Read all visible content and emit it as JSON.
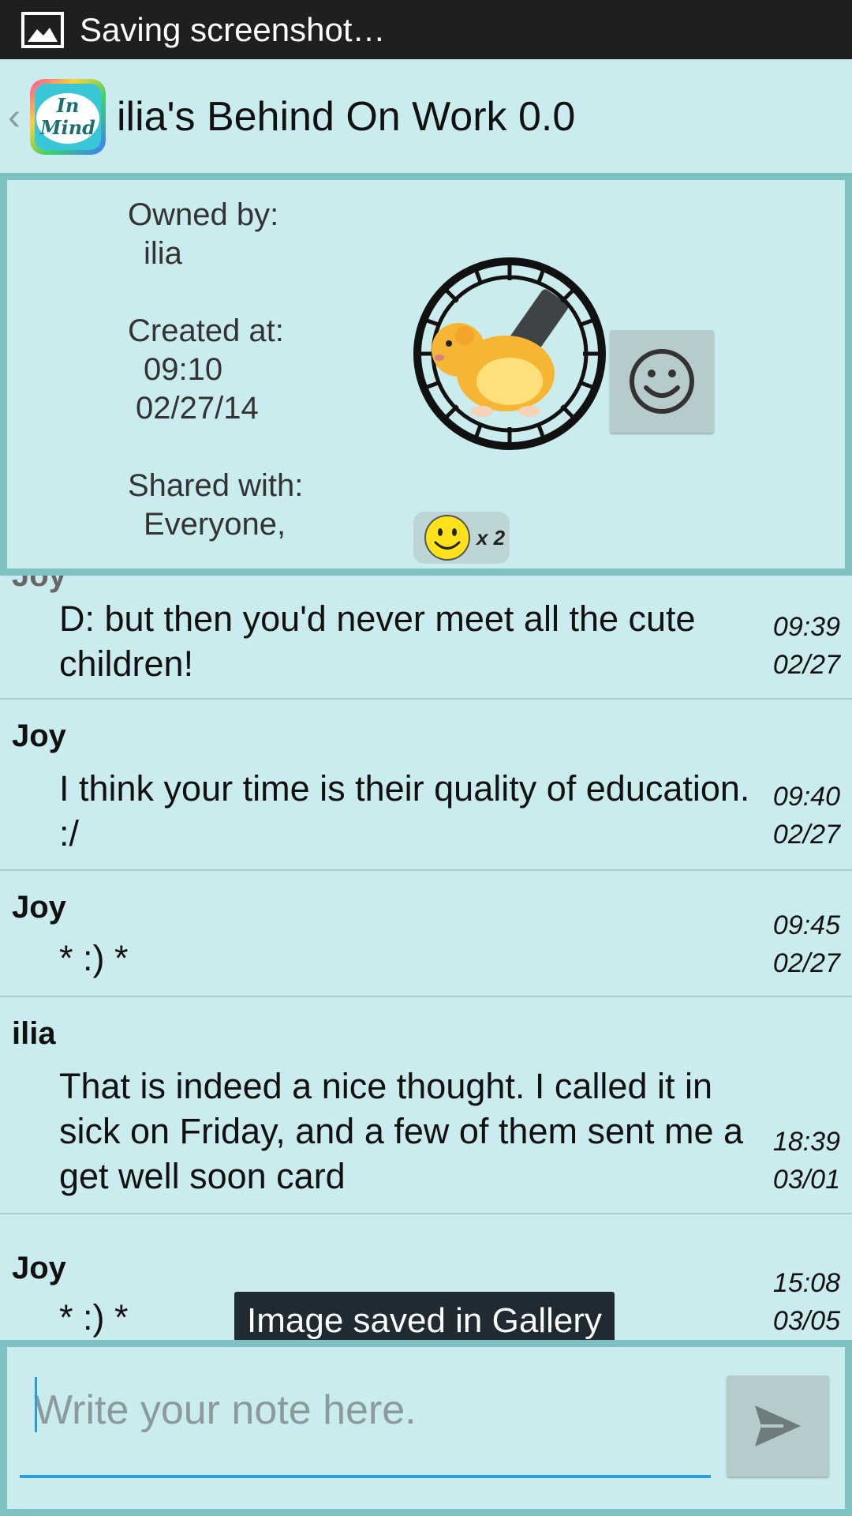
{
  "status_bar": {
    "text": "Saving screenshot…",
    "icon": "gallery-icon"
  },
  "action_bar": {
    "title": "ilia's Behind On Work 0.0",
    "app_icon_text": [
      "In",
      "Mind"
    ]
  },
  "info": {
    "owned_label": "Owned by:",
    "owner": "ilia",
    "created_label": "Created at:",
    "created_time": "09:10",
    "created_date": "02/27/14",
    "shared_label": "Shared with:",
    "shared_with": "Everyone,",
    "reaction_count": "x 2"
  },
  "messages": [
    {
      "author": "Joy",
      "text": "D: but then you'd never meet all the cute children!",
      "time": "09:39",
      "date": "02/27"
    },
    {
      "author": "Joy",
      "text": "I think your time is their quality of education. :/",
      "time": "09:40",
      "date": "02/27"
    },
    {
      "author": "Joy",
      "text": "* :) *",
      "time": "09:45",
      "date": "02/27"
    },
    {
      "author": "ilia",
      "text": "That is indeed a nice thought. I called it in sick on Friday, and a few of them sent me a get well soon card",
      "time": "18:39",
      "date": "03/01"
    },
    {
      "author": "Joy",
      "text": "* :) *",
      "time": "15:08",
      "date": "03/05"
    }
  ],
  "toast": "Image saved in Gallery",
  "composer": {
    "placeholder": "Write your note here."
  },
  "colors": {
    "background": "#cbecee",
    "border": "#7fc0c0",
    "accent": "#2b9ed8"
  }
}
